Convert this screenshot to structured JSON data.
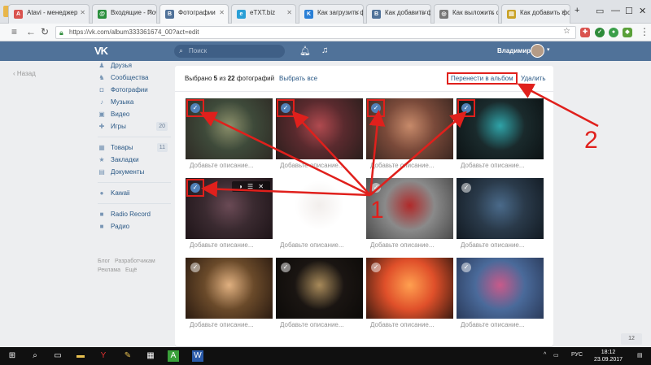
{
  "browser": {
    "tabs": [
      {
        "label": "Atavi - менеджер",
        "icon": "atavi-icon",
        "color": "#d9534f",
        "glyph": "A"
      },
      {
        "label": "Входящие - Почта",
        "icon": "mail-icon",
        "color": "#2a8f3d",
        "glyph": "@"
      },
      {
        "label": "Фотографии",
        "icon": "vk-icon",
        "color": "#507299",
        "glyph": "В"
      },
      {
        "label": "eTXT.biz",
        "icon": "etxt-icon",
        "color": "#2a9fd6",
        "glyph": "e"
      },
      {
        "label": "Как загрузить фото",
        "icon": "search-icon",
        "color": "#2a7fd6",
        "glyph": "K"
      },
      {
        "label": "Как добавить фото",
        "icon": "vk-icon",
        "color": "#507299",
        "glyph": "В"
      },
      {
        "label": "Как выложить фото",
        "icon": "globe-icon",
        "color": "#777777",
        "glyph": "◎"
      },
      {
        "label": "Как добавить фото",
        "icon": "page-icon",
        "color": "#c9a227",
        "glyph": "▤"
      }
    ],
    "url": "https://vk.com/album333361674_00?act=edit"
  },
  "vk": {
    "logo": "VK",
    "search_placeholder": "Поиск",
    "user_name": "Владимир",
    "back_label": "Назад",
    "sidebar": [
      {
        "label": "Друзья",
        "icon": "friends-icon",
        "glyph": "♟"
      },
      {
        "label": "Сообщества",
        "icon": "groups-icon",
        "glyph": "♞"
      },
      {
        "label": "Фотографии",
        "icon": "camera-icon",
        "glyph": "◘"
      },
      {
        "label": "Музыка",
        "icon": "music-icon",
        "glyph": "♪"
      },
      {
        "label": "Видео",
        "icon": "video-icon",
        "glyph": "▣"
      },
      {
        "label": "Игры",
        "icon": "games-icon",
        "glyph": "✚",
        "count": "20"
      }
    ],
    "sidebar2": [
      {
        "label": "Товары",
        "icon": "market-icon",
        "glyph": "▦",
        "count": "11"
      },
      {
        "label": "Закладки",
        "icon": "bookmark-icon",
        "glyph": "★"
      },
      {
        "label": "Документы",
        "icon": "document-icon",
        "glyph": "▤"
      }
    ],
    "sidebar3": [
      {
        "label": "Kawaii",
        "icon": "app-icon",
        "glyph": "●"
      }
    ],
    "sidebar4": [
      {
        "label": "Radio Record",
        "icon": "app-icon",
        "glyph": "■"
      },
      {
        "label": "Радио",
        "icon": "app-icon",
        "glyph": "■"
      }
    ],
    "footer_links": [
      "Блог",
      "Разработчикам",
      "Реклама",
      "Ещё"
    ],
    "selection": {
      "prefix": "Выбрано",
      "count": "5",
      "middle": "из",
      "total": "22",
      "suffix": "фотографий"
    },
    "select_all": "Выбрать все",
    "move_to_album": "Перенести в альбом",
    "delete": "Удалить",
    "desc_placeholder": "Добавьте описание...",
    "photo_overlay": "◑ ☰ ✕",
    "page_counter": "12"
  },
  "photos": [
    {
      "selected": true,
      "colors": [
        "#3e4a3a",
        "#8b8f6a",
        "#2e2a24"
      ]
    },
    {
      "selected": true,
      "colors": [
        "#5a2a2e",
        "#b04a4f",
        "#2a1e1c"
      ]
    },
    {
      "selected": true,
      "colors": [
        "#7a4a3a",
        "#c78a6a",
        "#3a2620"
      ]
    },
    {
      "selected": true,
      "colors": [
        "#1a2a2c",
        "#2fa3a8",
        "#0c1214"
      ]
    },
    {
      "selected": true,
      "colors": [
        "#3a2a30",
        "#6a4a55",
        "#1e1418"
      ],
      "overlay": true
    },
    {
      "selected": false,
      "colors": [
        "#ffffff",
        "#f2eeec",
        "#ffffff"
      ]
    },
    {
      "selected": false,
      "colors": [
        "#8a8a8a",
        "#b02a2a",
        "#4a4a4a"
      ]
    },
    {
      "selected": false,
      "colors": [
        "#2a3a4a",
        "#4a6a8a",
        "#121a22"
      ]
    },
    {
      "selected": false,
      "colors": [
        "#6a4a2a",
        "#e0b080",
        "#2a1a10"
      ]
    },
    {
      "selected": false,
      "colors": [
        "#1a1512",
        "#a88a5a",
        "#0c0a08"
      ]
    },
    {
      "selected": false,
      "colors": [
        "#e0502a",
        "#ffa050",
        "#3a1a10"
      ]
    },
    {
      "selected": false,
      "colors": [
        "#4a6a9a",
        "#c85a8a",
        "#2a3a5a"
      ]
    }
  ],
  "annotations": {
    "label1": "1",
    "label2": "2",
    "color": "#e0201c"
  },
  "taskbar": {
    "lang": "РУС",
    "time": "18:12",
    "date": "23.09.2017"
  }
}
